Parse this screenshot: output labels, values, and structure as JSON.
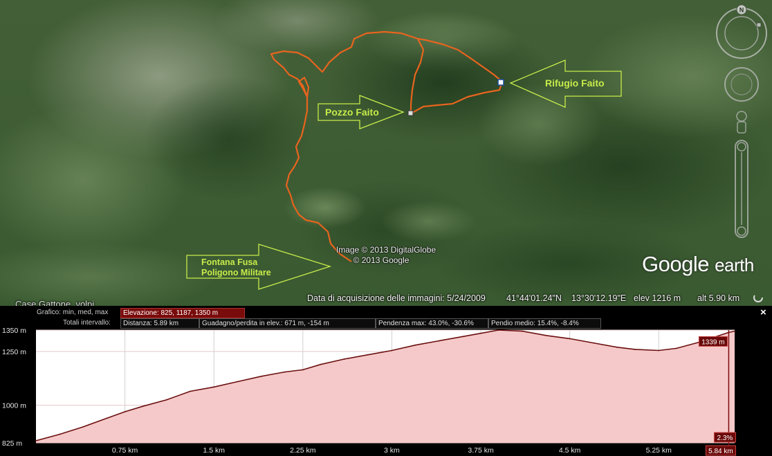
{
  "map": {
    "places": [
      {
        "id": "pozzo",
        "label": "Pozzo Faito"
      },
      {
        "id": "rifugio",
        "label": "Rifugio Faito"
      },
      {
        "id": "fontana",
        "label": "Fontana Fusa"
      },
      {
        "id": "poligono",
        "label": "Poligono Militare"
      }
    ],
    "copyright_line1": "Image © 2013 DigitalGlobe",
    "copyright_line2": "© 2013 Google",
    "partial_place_label": "Case Gattone, volpi",
    "logo": {
      "google": "Google",
      "earth": "earth"
    },
    "compass_letter": "N",
    "route_color": "#e8641e",
    "label_color": "#c8ec4a"
  },
  "status_bar": {
    "acquisition": "Data di acquisizione delle immagini: 5/24/2009",
    "lat": "41°44'01.24\"N",
    "lon": "13°30'12.19\"E",
    "elev": "elev  1216 m",
    "alt": "alt   5.90 km"
  },
  "profile": {
    "graph_label": "Grafico: min, med, max",
    "graph_value": "Elevazione: 825, 1187, 1350 m",
    "totals_label": "Totali intervallo:",
    "distance": "Distanza: 5.89 km",
    "gain_loss": "Guadagno/perdita in elev.: 671 m, -154 m",
    "max_slope": "Pendenza max: 43.0%, -30.6%",
    "avg_slope": "Pendio medio: 15.4%, -8.4%",
    "close_symbol": "×",
    "cursor_elevation": "1339 m",
    "cursor_slope": "2.3%",
    "cursor_distance": "5.84 km"
  },
  "chart_data": {
    "type": "area",
    "title": "",
    "xlabel": "",
    "ylabel": "",
    "x_unit": "km",
    "y_unit": "m",
    "xlim": [
      0,
      5.89
    ],
    "ylim": [
      825,
      1350
    ],
    "y_tick_values": [
      825,
      1000,
      1250,
      1350
    ],
    "y_tick_labels": [
      "825 m",
      "1000 m",
      "1250 m",
      "1350 m"
    ],
    "x_tick_values": [
      0.75,
      1.5,
      2.25,
      3,
      3.75,
      4.5,
      5.25
    ],
    "x_tick_labels": [
      "0.75 km",
      "1.5 km",
      "2.25 km",
      "3 km",
      "3.75 km",
      "4.5 km",
      "5.25 km"
    ],
    "grid": true,
    "fill_color": "#f5c9c9",
    "line_color": "#6b0f0f",
    "series": [
      {
        "x": [
          0,
          0.2,
          0.4,
          0.6,
          0.75,
          0.9,
          1.1,
          1.3,
          1.5,
          1.7,
          1.9,
          2.1,
          2.25,
          2.4,
          2.6,
          2.8,
          3.0,
          3.2,
          3.4,
          3.6,
          3.75,
          3.9,
          4.1,
          4.3,
          4.5,
          4.7,
          4.9,
          5.05,
          5.25,
          5.4,
          5.6,
          5.84,
          5.89
        ],
        "y": [
          835,
          865,
          900,
          940,
          970,
          995,
          1025,
          1065,
          1085,
          1110,
          1135,
          1155,
          1165,
          1190,
          1215,
          1235,
          1255,
          1280,
          1300,
          1320,
          1335,
          1350,
          1345,
          1325,
          1310,
          1290,
          1270,
          1260,
          1255,
          1265,
          1295,
          1339,
          1345
        ]
      }
    ]
  }
}
